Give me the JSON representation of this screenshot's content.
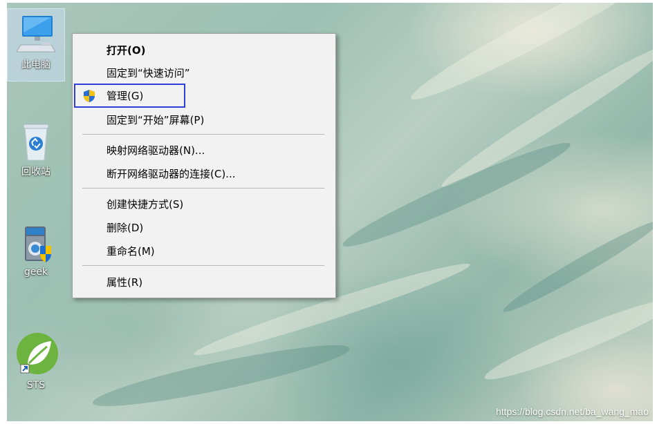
{
  "desktop": {
    "icons": [
      {
        "label": "此电脑",
        "icon": "computer-icon"
      },
      {
        "label": "回收站",
        "icon": "recycle-bin-icon"
      },
      {
        "label": "geek",
        "icon": "shield-folder-icon"
      },
      {
        "label": "STS",
        "icon": "spring-leaf-shortcut-icon"
      }
    ]
  },
  "context_menu": {
    "items": [
      {
        "label": "打开(O)"
      },
      {
        "label": "固定到“快速访问”"
      },
      {
        "label": "管理(G)",
        "icon": "uac-shield-icon"
      },
      {
        "label": "固定到“开始”屏幕(P)"
      },
      {
        "label": "映射网络驱动器(N)..."
      },
      {
        "label": "断开网络驱动器的连接(C)..."
      },
      {
        "label": "创建快捷方式(S)"
      },
      {
        "label": "删除(D)"
      },
      {
        "label": "重命名(M)"
      },
      {
        "label": "属性(R)"
      }
    ],
    "highlight_color": "#2d3fd6"
  },
  "watermark": "https://blog.csdn.net/ba_wang_mao"
}
